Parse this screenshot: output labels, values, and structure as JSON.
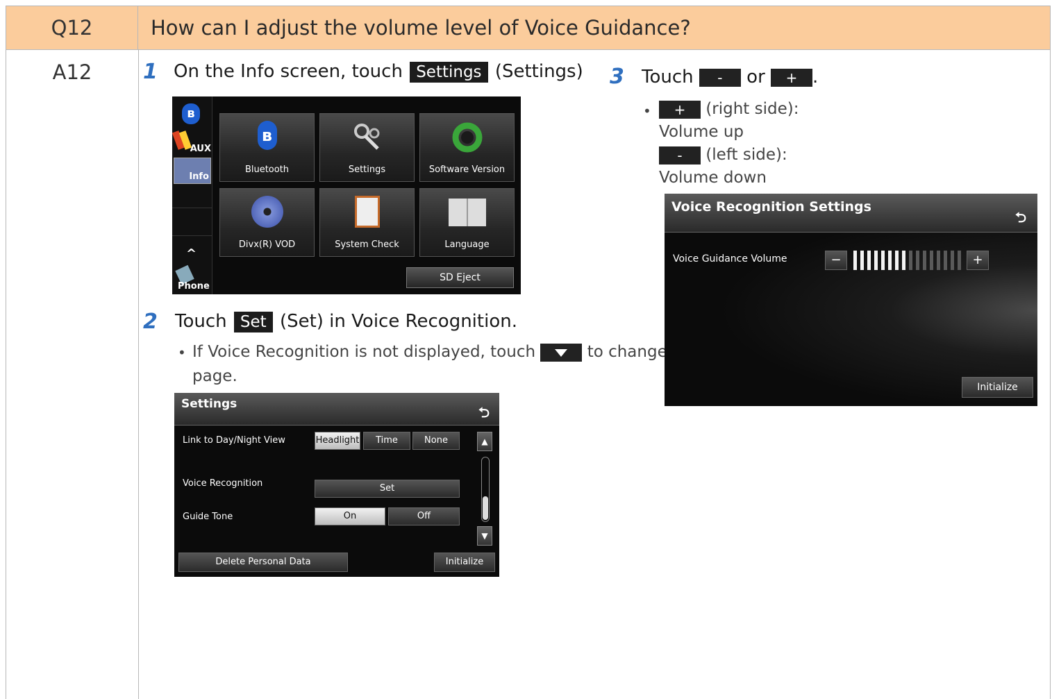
{
  "question": {
    "label": "Q12",
    "text": "How can I adjust the volume level of Voice Guidance?"
  },
  "answer": {
    "label": "A12"
  },
  "step1": {
    "num": "1",
    "prefix": "On the Info screen, touch",
    "button": "Settings",
    "suffix": "(Settings)"
  },
  "step2": {
    "num": "2",
    "prefix": "Touch",
    "button": "Set",
    "suffix": "(Set) in Voice Recognition.",
    "note_prefix": "If Voice Recognition is not displayed, touch",
    "note_suffix": "to change the",
    "note_line2": "page."
  },
  "step3": {
    "num": "3",
    "prefix": "Touch",
    "minus": "-",
    "or": "or",
    "plus": "+",
    "period": ".",
    "plus_desc": "(right side):",
    "plus_result": "Volume up",
    "minus_desc": "(left side):",
    "minus_result": "Volume down"
  },
  "info_screen": {
    "side_items": [
      "AUX",
      "Info",
      "Phone"
    ],
    "tiles": [
      "Bluetooth",
      "Settings",
      "Software Version",
      "Divx(R) VOD",
      "System Check",
      "Language"
    ],
    "sd_eject": "SD Eject"
  },
  "settings_screen": {
    "title": "Settings",
    "row1_label": "Link to Day/Night View",
    "row1_options": [
      "Headlight",
      "Time",
      "None"
    ],
    "row2_label": "Voice Recognition",
    "row2_button": "Set",
    "row3_label": "Guide Tone",
    "row3_options": [
      "On",
      "Off"
    ],
    "delete_button": "Delete Personal Data",
    "initialize_button": "Initialize"
  },
  "voice_screen": {
    "title": "Voice Recognition Settings",
    "row_label": "Voice Guidance Volume",
    "minus": "−",
    "plus": "+",
    "volume_level": 8,
    "volume_max": 16,
    "initialize_button": "Initialize"
  }
}
